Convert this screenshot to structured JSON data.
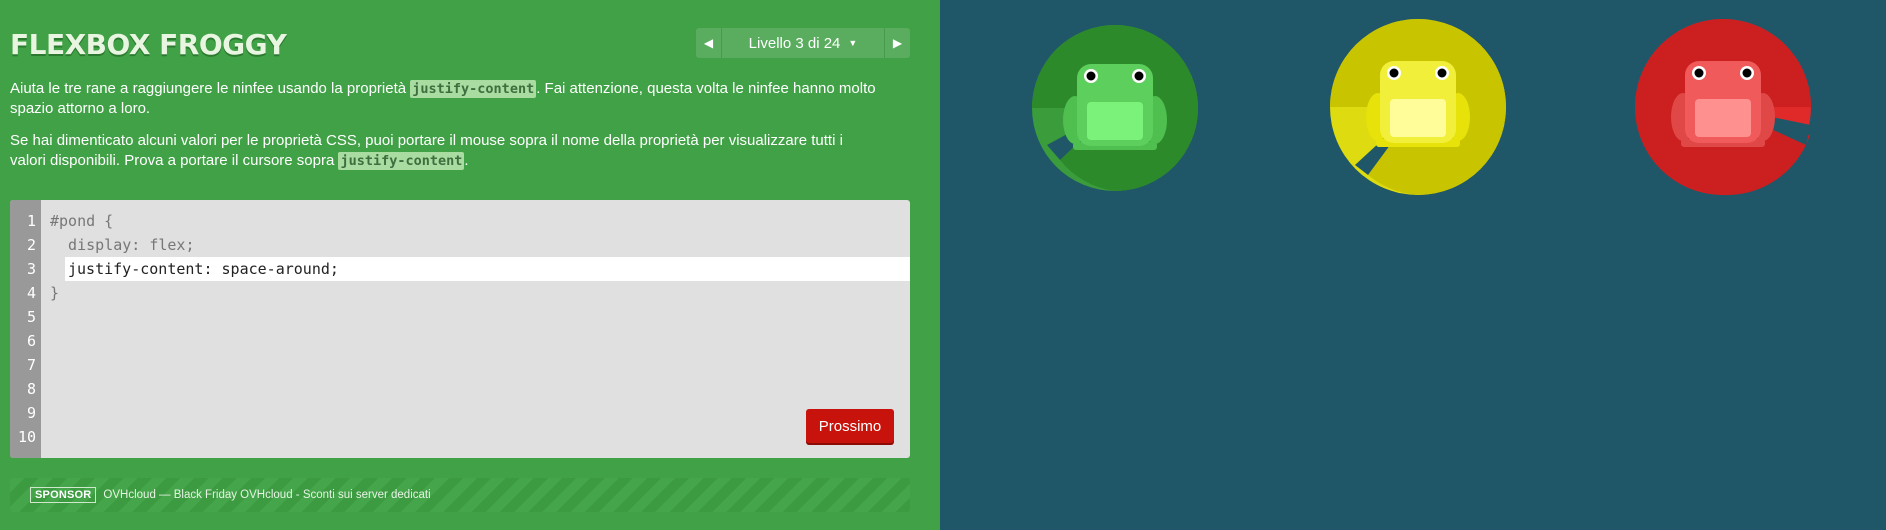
{
  "header": {
    "title": "FLEXBOX FROGGY",
    "level_label": "Livello 3 di 24",
    "prev_icon": "triangle-left-icon",
    "next_icon": "triangle-right-icon",
    "dropdown_icon": "caret-down-icon"
  },
  "instructions": {
    "p1_before": "Aiuta le tre rane a raggiungere le ninfee usando la proprietà ",
    "p1_code": "justify-content",
    "p1_after": ". Fai attenzione, questa volta le ninfee hanno molto spazio attorno a loro.",
    "p2_before": "Se hai dimenticato alcuni valori per le proprietà CSS, puoi portare il mouse sopra il nome della proprietà per visualizzare tutti i valori disponibili. Prova a portare il cursore sopra ",
    "p2_code": "justify-content",
    "p2_after": "."
  },
  "editor": {
    "line_numbers": [
      "1",
      "2",
      "3",
      "4",
      "5",
      "6",
      "7",
      "8",
      "9",
      "10"
    ],
    "line1": "#pond {",
    "line2": "  display: flex;",
    "input_value": "justify-content: space-around;",
    "line4": "}",
    "next_button": "Prossimo"
  },
  "sponsor": {
    "badge": "SPONSOR",
    "text": "OVHcloud — Black Friday OVHcloud - Sconti sui server dedicati"
  },
  "pond": {
    "frogs": [
      {
        "name": "green",
        "pad_color": "#2d8a2a",
        "pad_shade": "#3a9c3b",
        "frog_color": "#5ccf5c",
        "belly": "#7bf37b"
      },
      {
        "name": "yellow",
        "pad_color": "#c8c400",
        "pad_shade": "#dedb10",
        "frog_color": "#f2ef3a",
        "belly": "#fffd9a"
      },
      {
        "name": "red",
        "pad_color": "#cc1f1f",
        "pad_shade": "#e02a2a",
        "frog_color": "#f05a5a",
        "belly": "#ff9090"
      }
    ]
  },
  "colors": {
    "sidebar": "#41a146",
    "pond": "#1f5768",
    "button": "#c8130c"
  }
}
